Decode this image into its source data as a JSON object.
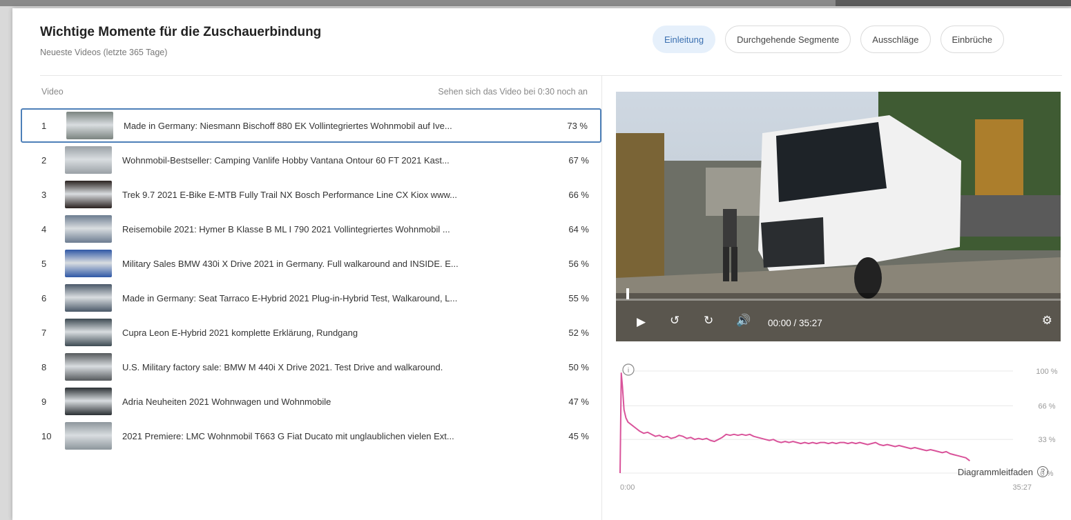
{
  "header": {
    "title": "Wichtige Momente für die Zuschauerbindung",
    "subtitle": "Neueste Videos (letzte 365 Tage)"
  },
  "tabs": [
    {
      "label": "Einleitung",
      "active": true
    },
    {
      "label": "Durchgehende Segmente",
      "active": false
    },
    {
      "label": "Ausschläge",
      "active": false
    },
    {
      "label": "Einbrüche",
      "active": false
    }
  ],
  "table": {
    "col_video": "Video",
    "col_metric": "Sehen sich das Video bei 0:30 noch an",
    "rows": [
      {
        "num": "1",
        "title": "Made in Germany: Niesmann Bischoff 880 EK Vollintegriertes Wohnmobil auf Ive...",
        "pct": "73 %",
        "thumb": "#7b8480"
      },
      {
        "num": "2",
        "title": "Wohnmobil-Bestseller: Camping Vanlife Hobby Vantana Ontour 60 FT 2021 Kast...",
        "pct": "67 %",
        "thumb": "#9aa1a6"
      },
      {
        "num": "3",
        "title": "Trek 9.7 2021 E-Bike E-MTB Fully Trail NX Bosch Performance Line CX Kiox www...",
        "pct": "66 %",
        "thumb": "#2a2220"
      },
      {
        "num": "4",
        "title": "Reisemobile 2021: Hymer B Klasse B ML I 790 2021 Vollintegriertes Wohnmobil ...",
        "pct": "64 %",
        "thumb": "#6c7c90"
      },
      {
        "num": "5",
        "title": "Military Sales BMW 430i X Drive 2021 in Germany. Full walkaround and INSIDE. E...",
        "pct": "56 %",
        "thumb": "#2f58a6"
      },
      {
        "num": "6",
        "title": "Made in Germany: Seat Tarraco E-Hybrid 2021 Plug-in-Hybrid Test, Walkaround, L...",
        "pct": "55 %",
        "thumb": "#4a5868"
      },
      {
        "num": "7",
        "title": "Cupra Leon E-Hybrid 2021 komplette Erklärung, Rundgang",
        "pct": "52 %",
        "thumb": "#3d4a52"
      },
      {
        "num": "8",
        "title": "U.S. Military factory sale: BMW M 440i X Drive 2021. Test Drive and walkaround.",
        "pct": "50 %",
        "thumb": "#55595c"
      },
      {
        "num": "9",
        "title": "Adria Neuheiten 2021 Wohnwagen und Wohnmobile",
        "pct": "47 %",
        "thumb": "#2b3034"
      },
      {
        "num": "10",
        "title": "2021 Premiere: LMC Wohnmobil T663 G Fiat Ducato mit unglaublichen vielen Ext...",
        "pct": "45 %",
        "thumb": "#8d969c"
      }
    ]
  },
  "player": {
    "time": "00:00 / 35:27",
    "icons": [
      "play-icon",
      "rewind-icon",
      "forward-icon",
      "volume-icon",
      "settings-icon"
    ]
  },
  "chart_data": {
    "type": "line",
    "title": "",
    "xlabel": "",
    "ylabel": "",
    "x_ticks": [
      "0:00",
      "35:27"
    ],
    "y_ticks": [
      "100 %",
      "66 %",
      "33 %",
      "0 %"
    ],
    "ylim": [
      0,
      100
    ],
    "xlim": [
      0,
      100
    ],
    "grid": true,
    "color": "#d9539a",
    "series": [
      {
        "x": [
          0,
          0.3,
          0.6,
          1,
          1.5,
          2,
          3,
          4,
          5,
          6,
          7,
          8,
          9,
          10,
          11,
          12,
          13,
          14,
          15,
          16,
          17,
          18,
          19,
          20,
          21,
          22,
          23,
          24,
          25,
          26,
          27,
          28,
          29,
          30,
          31,
          32,
          33,
          34,
          35,
          36,
          37,
          38,
          39,
          40,
          41,
          42,
          43,
          44,
          45,
          46,
          47,
          48,
          49,
          50,
          51,
          52,
          53,
          54,
          55,
          56,
          57,
          58,
          59,
          60,
          61,
          62,
          63,
          64,
          65,
          66,
          67,
          68,
          69,
          70,
          71,
          72,
          73,
          74,
          75,
          76,
          77,
          78,
          79,
          80,
          81,
          82,
          83,
          84,
          85,
          86,
          87,
          88,
          89
        ],
        "y": [
          0,
          98,
          85,
          62,
          54,
          50,
          47,
          44,
          41,
          39,
          40,
          38,
          36,
          37,
          35,
          36,
          34,
          35,
          37,
          36,
          34,
          35,
          33,
          34,
          33,
          34,
          32,
          31,
          33,
          35,
          38,
          37,
          38,
          37,
          38,
          37,
          38,
          36,
          35,
          34,
          33,
          32,
          33,
          31,
          30,
          31,
          30,
          31,
          30,
          29,
          30,
          29,
          30,
          29,
          30,
          30,
          29,
          30,
          29,
          30,
          30,
          29,
          30,
          29,
          30,
          29,
          28,
          29,
          30,
          28,
          27,
          28,
          27,
          26,
          27,
          26,
          25,
          24,
          25,
          24,
          23,
          22,
          23,
          22,
          21,
          20,
          21,
          19,
          18,
          17,
          16,
          15,
          12
        ]
      }
    ],
    "guide_label": "Diagrammleitfaden"
  }
}
